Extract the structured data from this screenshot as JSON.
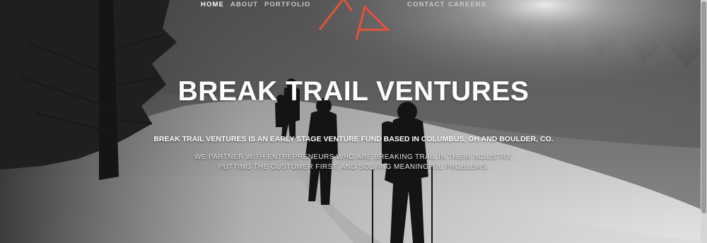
{
  "nav": {
    "items": [
      {
        "label": "HOME",
        "active": true
      },
      {
        "label": "ABOUT",
        "active": false
      },
      {
        "label": "PORTFOLIO",
        "active": false
      },
      {
        "label": "CONTACT",
        "active": false
      },
      {
        "label": "CAREERS",
        "active": false
      }
    ]
  },
  "logo": {
    "icon": "break-trail-triangle-logo",
    "color": "#e4533a"
  },
  "hero": {
    "title": "BREAK TRAIL VENTURES",
    "tagline": "BREAK TRAIL VENTURES IS AN EARLY STAGE VENTURE FUND BASED IN COLUMBUS, OH AND BOULDER, CO.",
    "mission": "WE PARTNER WITH ENTREPRENEURS WHO ARE BREAKING TRAIL IN THEIR INDUSTRY, PUTTING THE CUSTOMER FIRST, AND SOLVING MEANINGFUL PROBLEMS."
  },
  "colors": {
    "accent": "#e4533a",
    "text": "#ffffff"
  }
}
